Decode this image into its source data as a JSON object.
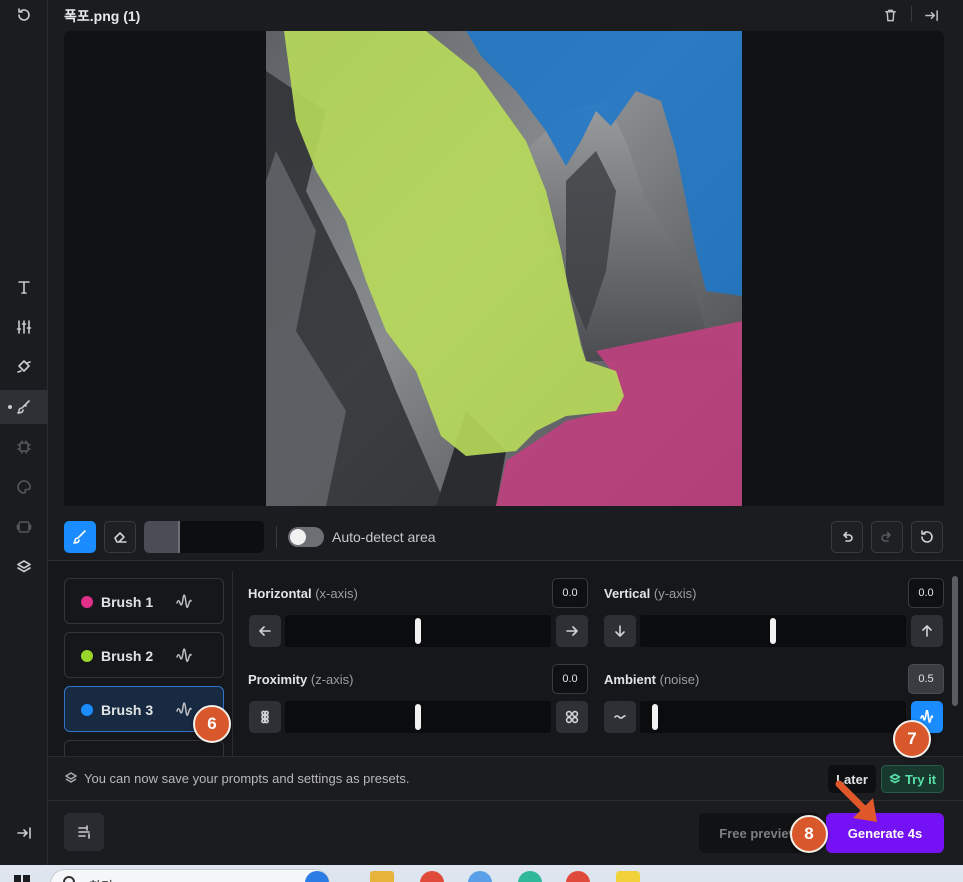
{
  "header": {
    "title": "폭포.png (1)"
  },
  "rail": {
    "items": [
      "refresh-icon",
      "text-icon",
      "sliders-icon",
      "transform-icon",
      "brush-icon",
      "chip-icon",
      "palette-icon",
      "frame-icon",
      "layers-icon"
    ],
    "active": "brush-icon"
  },
  "toolbar": {
    "auto_detect_label": "Auto-detect area",
    "auto_detect_on": false
  },
  "brushes": [
    {
      "label": "Brush 1",
      "color": "#e0308a"
    },
    {
      "label": "Brush 2",
      "color": "#9bd42a"
    },
    {
      "label": "Brush 3",
      "color": "#1a8cff",
      "selected": true
    }
  ],
  "controls": {
    "horizontal": {
      "label": "Horizontal",
      "sub": "(x-axis)",
      "value": "0.0"
    },
    "vertical": {
      "label": "Vertical",
      "sub": "(y-axis)",
      "value": "0.0"
    },
    "proximity": {
      "label": "Proximity",
      "sub": "(z-axis)",
      "value": "0.0"
    },
    "ambient": {
      "label": "Ambient",
      "sub": "(noise)",
      "value": "0.5"
    }
  },
  "notice": {
    "text": "You can now save your prompts and settings as presets.",
    "later_label": "Later",
    "try_label": "Try it"
  },
  "footer": {
    "free_preview_label": "Free preview",
    "generate_label": "Generate 4s"
  },
  "markers": [
    "6",
    "7",
    "8"
  ],
  "taskbar": {
    "search_text": "찾기"
  },
  "colors": {
    "accent_blue": "#1a8cff",
    "generate_purple": "#7512f5",
    "marker_orange": "#d9582b",
    "mask_green": "#b8dc5a",
    "mask_blue": "#1f78c8",
    "mask_pink": "#c0407e"
  }
}
